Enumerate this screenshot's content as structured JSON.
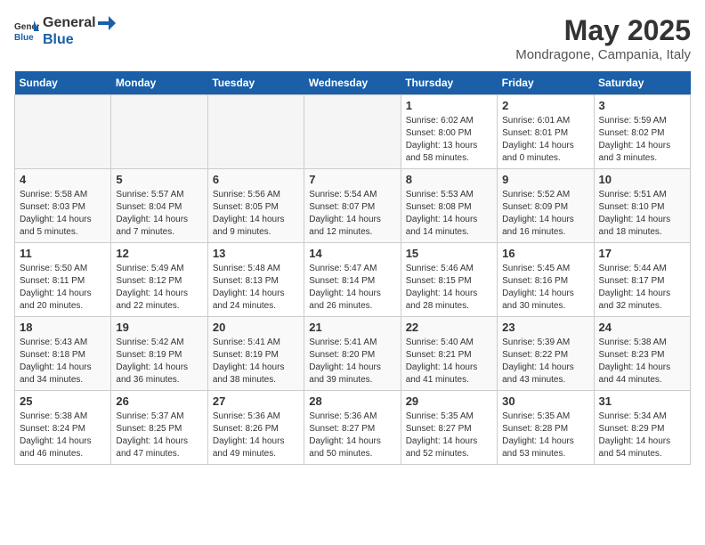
{
  "header": {
    "logo_general": "General",
    "logo_blue": "Blue",
    "month_year": "May 2025",
    "location": "Mondragone, Campania, Italy"
  },
  "days_of_week": [
    "Sunday",
    "Monday",
    "Tuesday",
    "Wednesday",
    "Thursday",
    "Friday",
    "Saturday"
  ],
  "weeks": [
    [
      {
        "day": "",
        "info": ""
      },
      {
        "day": "",
        "info": ""
      },
      {
        "day": "",
        "info": ""
      },
      {
        "day": "",
        "info": ""
      },
      {
        "day": "1",
        "info": "Sunrise: 6:02 AM\nSunset: 8:00 PM\nDaylight: 13 hours\nand 58 minutes."
      },
      {
        "day": "2",
        "info": "Sunrise: 6:01 AM\nSunset: 8:01 PM\nDaylight: 14 hours\nand 0 minutes."
      },
      {
        "day": "3",
        "info": "Sunrise: 5:59 AM\nSunset: 8:02 PM\nDaylight: 14 hours\nand 3 minutes."
      }
    ],
    [
      {
        "day": "4",
        "info": "Sunrise: 5:58 AM\nSunset: 8:03 PM\nDaylight: 14 hours\nand 5 minutes."
      },
      {
        "day": "5",
        "info": "Sunrise: 5:57 AM\nSunset: 8:04 PM\nDaylight: 14 hours\nand 7 minutes."
      },
      {
        "day": "6",
        "info": "Sunrise: 5:56 AM\nSunset: 8:05 PM\nDaylight: 14 hours\nand 9 minutes."
      },
      {
        "day": "7",
        "info": "Sunrise: 5:54 AM\nSunset: 8:07 PM\nDaylight: 14 hours\nand 12 minutes."
      },
      {
        "day": "8",
        "info": "Sunrise: 5:53 AM\nSunset: 8:08 PM\nDaylight: 14 hours\nand 14 minutes."
      },
      {
        "day": "9",
        "info": "Sunrise: 5:52 AM\nSunset: 8:09 PM\nDaylight: 14 hours\nand 16 minutes."
      },
      {
        "day": "10",
        "info": "Sunrise: 5:51 AM\nSunset: 8:10 PM\nDaylight: 14 hours\nand 18 minutes."
      }
    ],
    [
      {
        "day": "11",
        "info": "Sunrise: 5:50 AM\nSunset: 8:11 PM\nDaylight: 14 hours\nand 20 minutes."
      },
      {
        "day": "12",
        "info": "Sunrise: 5:49 AM\nSunset: 8:12 PM\nDaylight: 14 hours\nand 22 minutes."
      },
      {
        "day": "13",
        "info": "Sunrise: 5:48 AM\nSunset: 8:13 PM\nDaylight: 14 hours\nand 24 minutes."
      },
      {
        "day": "14",
        "info": "Sunrise: 5:47 AM\nSunset: 8:14 PM\nDaylight: 14 hours\nand 26 minutes."
      },
      {
        "day": "15",
        "info": "Sunrise: 5:46 AM\nSunset: 8:15 PM\nDaylight: 14 hours\nand 28 minutes."
      },
      {
        "day": "16",
        "info": "Sunrise: 5:45 AM\nSunset: 8:16 PM\nDaylight: 14 hours\nand 30 minutes."
      },
      {
        "day": "17",
        "info": "Sunrise: 5:44 AM\nSunset: 8:17 PM\nDaylight: 14 hours\nand 32 minutes."
      }
    ],
    [
      {
        "day": "18",
        "info": "Sunrise: 5:43 AM\nSunset: 8:18 PM\nDaylight: 14 hours\nand 34 minutes."
      },
      {
        "day": "19",
        "info": "Sunrise: 5:42 AM\nSunset: 8:19 PM\nDaylight: 14 hours\nand 36 minutes."
      },
      {
        "day": "20",
        "info": "Sunrise: 5:41 AM\nSunset: 8:19 PM\nDaylight: 14 hours\nand 38 minutes."
      },
      {
        "day": "21",
        "info": "Sunrise: 5:41 AM\nSunset: 8:20 PM\nDaylight: 14 hours\nand 39 minutes."
      },
      {
        "day": "22",
        "info": "Sunrise: 5:40 AM\nSunset: 8:21 PM\nDaylight: 14 hours\nand 41 minutes."
      },
      {
        "day": "23",
        "info": "Sunrise: 5:39 AM\nSunset: 8:22 PM\nDaylight: 14 hours\nand 43 minutes."
      },
      {
        "day": "24",
        "info": "Sunrise: 5:38 AM\nSunset: 8:23 PM\nDaylight: 14 hours\nand 44 minutes."
      }
    ],
    [
      {
        "day": "25",
        "info": "Sunrise: 5:38 AM\nSunset: 8:24 PM\nDaylight: 14 hours\nand 46 minutes."
      },
      {
        "day": "26",
        "info": "Sunrise: 5:37 AM\nSunset: 8:25 PM\nDaylight: 14 hours\nand 47 minutes."
      },
      {
        "day": "27",
        "info": "Sunrise: 5:36 AM\nSunset: 8:26 PM\nDaylight: 14 hours\nand 49 minutes."
      },
      {
        "day": "28",
        "info": "Sunrise: 5:36 AM\nSunset: 8:27 PM\nDaylight: 14 hours\nand 50 minutes."
      },
      {
        "day": "29",
        "info": "Sunrise: 5:35 AM\nSunset: 8:27 PM\nDaylight: 14 hours\nand 52 minutes."
      },
      {
        "day": "30",
        "info": "Sunrise: 5:35 AM\nSunset: 8:28 PM\nDaylight: 14 hours\nand 53 minutes."
      },
      {
        "day": "31",
        "info": "Sunrise: 5:34 AM\nSunset: 8:29 PM\nDaylight: 14 hours\nand 54 minutes."
      }
    ]
  ]
}
